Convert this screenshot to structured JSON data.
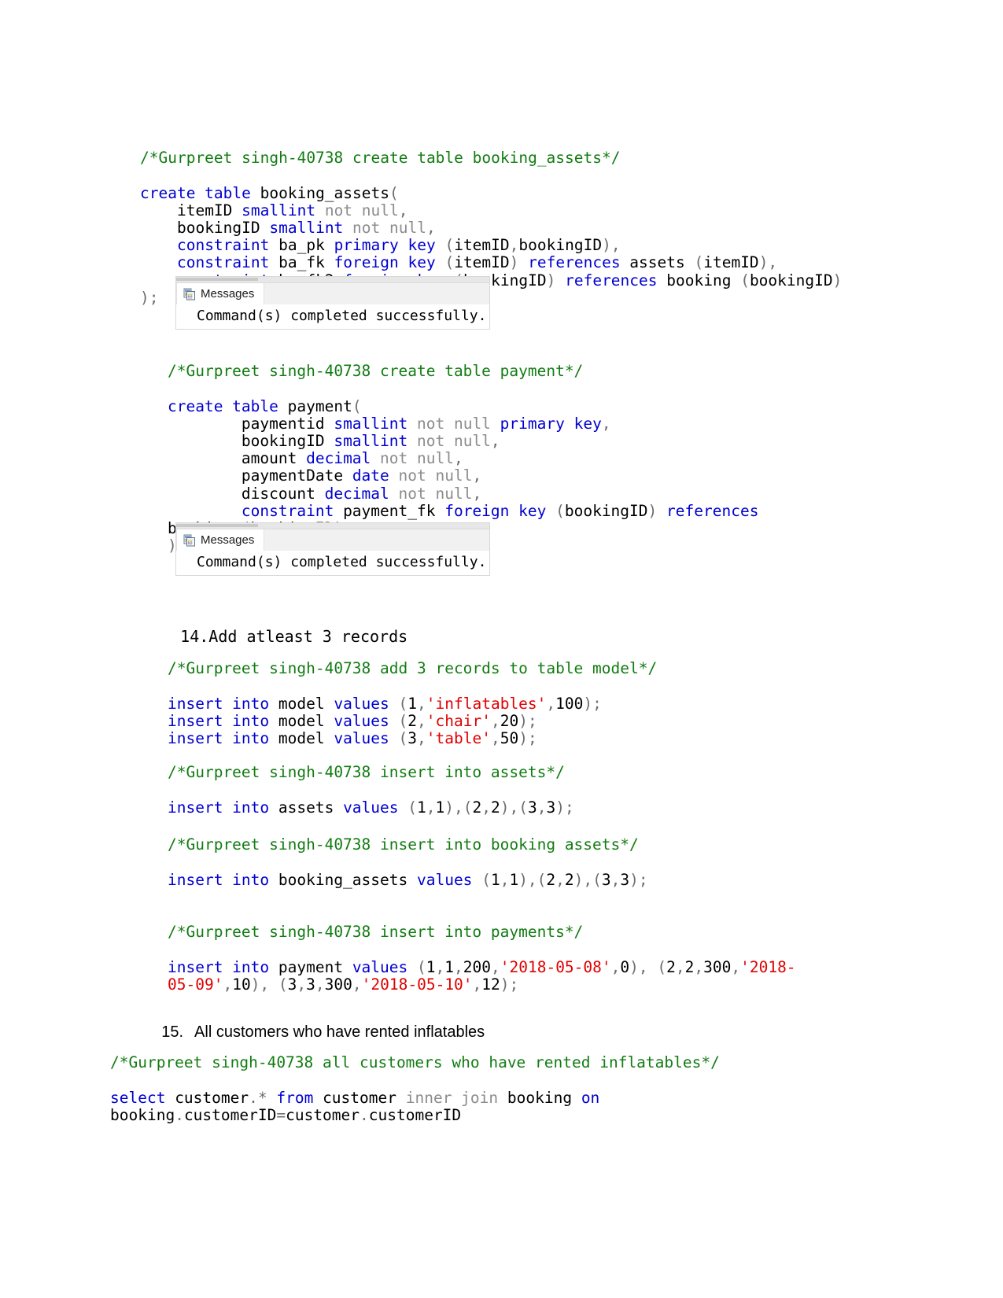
{
  "document": {
    "author_tag": "Gurpreet singh-40738",
    "colors": {
      "keyword": "#0000d0",
      "comment": "#127c12",
      "string": "#e00000",
      "muted": "#8c8c8c",
      "punctuation": "#6e6e6e",
      "plain": "#000000"
    }
  },
  "block_booking_assets": {
    "comment": "/*Gurpreet singh-40738 create table booking_assets*/",
    "lines": [
      "create table booking_assets(",
      "    itemID smallint not null,",
      "    bookingID smallint not null,",
      "    constraint ba_pk primary key (itemID,bookingID),",
      "    constraint ba_fk foreign key (itemID) references assets (itemID),",
      "    constraint ba_fk2 foreign key (bookingID) references booking (bookingID)",
      ");"
    ]
  },
  "messages_pane_1": {
    "tab_label": "Messages",
    "icon": "messages-grid-icon",
    "body_text": "Command(s) completed successfully."
  },
  "block_payment": {
    "comment": "/*Gurpreet singh-40738 create table payment*/",
    "lines": [
      "create table payment(",
      "        paymentid smallint not null primary key,",
      "        bookingID smallint not null,",
      "        amount decimal not null,",
      "        paymentDate date not null,",
      "        discount decimal not null,",
      "        constraint payment_fk foreign key (bookingID) references booking (bookingID)",
      ");"
    ]
  },
  "messages_pane_2": {
    "tab_label": "Messages",
    "icon": "messages-grid-icon",
    "body_text": "Command(s) completed successfully."
  },
  "item_14": {
    "number": "14.",
    "text": "Add atleast 3 records"
  },
  "block_model_inserts": {
    "comment": "/*Gurpreet singh-40738 add 3 records to table model*/",
    "lines": [
      "insert into model values (1,'inflatables',100);",
      "insert into model values (2,'chair',20);",
      "insert into model values (3,'table',50);"
    ]
  },
  "block_assets_inserts": {
    "comment": "/*Gurpreet singh-40738 insert into assets*/",
    "lines": [
      "insert into assets values (1,1),(2,2),(3,3);"
    ]
  },
  "block_booking_assets_inserts": {
    "comment": "/*Gurpreet singh-40738 insert into booking assets*/",
    "lines": [
      "insert into booking_assets values (1,1),(2,2),(3,3);"
    ]
  },
  "block_payment_inserts": {
    "comment": "/*Gurpreet singh-40738 insert into payments*/",
    "lines": [
      "insert into payment values (1,1,200,'2018-05-08',0), (2,2,300,'2018-05-09',10), (3,3,300,'2018-05-10',12);"
    ]
  },
  "item_15": {
    "number": "15.",
    "text": "All customers who have rented inflatables"
  },
  "block_select_customers": {
    "comment": "/*Gurpreet singh-40738 all customers who have rented inflatables*/",
    "lines": [
      "select customer.* from customer inner join booking on booking.customerID=customer.customerID"
    ]
  }
}
